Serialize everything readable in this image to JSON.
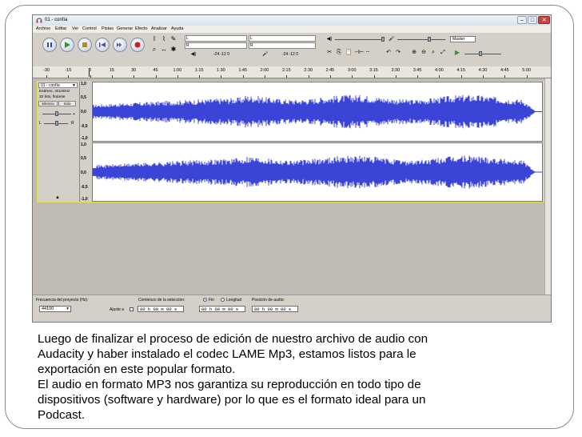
{
  "window": {
    "title": "01 - confía",
    "controls": [
      "–",
      "□",
      "✕"
    ]
  },
  "menu": [
    "Archivo",
    "Editar",
    "Ver",
    "Control",
    "Pistas",
    "Generar",
    "Efecto",
    "Analizar",
    "Ayuda"
  ],
  "toolbar": {
    "transport": [
      "pause-icon",
      "play-icon",
      "stop-icon",
      "skip-start-icon",
      "skip-end-icon",
      "record-icon"
    ],
    "meter_l": "L",
    "meter_r": "R",
    "meter_scale": "-24 -12 0",
    "meter_scale_2": "-24 -12 0",
    "mixer_label": "Master"
  },
  "ruler": {
    "ticks": [
      "-30",
      "-15",
      "0",
      "15",
      "30",
      "45",
      "1:00",
      "1:15",
      "1:30",
      "1:45",
      "2:00",
      "2:15",
      "2:30",
      "2:45",
      "3:00",
      "3:15",
      "3:30",
      "3:45",
      "4:00",
      "4:15",
      "4:30",
      "4:45",
      "5:00"
    ]
  },
  "track": {
    "name": "01 - confía",
    "info1": "Estéreo, 44100Hz",
    "info2": "32 bits, flotante",
    "mute": "Silencio",
    "solo": "Solo",
    "pan_l": "L",
    "pan_r": "R",
    "scale": [
      "1,0",
      "0,5",
      "0,0",
      "-0,5",
      "-1,0"
    ]
  },
  "status": {
    "rate_label": "Frecuencia del proyecto (Hz):",
    "rate_value": "44100",
    "selection_label": "Comienzo de la selección:",
    "end_option": "Fin",
    "length_option": "Longitud",
    "position_label": "Posición de audio:",
    "snap_label": "Ajuste a",
    "time_start": "00 h 00 m 00 s",
    "time_end": "00 h 00 m 00 s",
    "time_position": "00 h 00 m 00 s"
  },
  "caption": {
    "line1": "Luego de finalizar el proceso de edición de nuestro archivo de audio con",
    "line2": "Audacity y haber instalado el codec LAME Mp3, estamos listos para le",
    "line3": "exportación en este popular formato.",
    "line4": "El audio en formato MP3 nos garantiza su reproducción en todo tipo de",
    "line5": "dispositivos (software y hardware) por lo que es el formato ideal para un",
    "line6": "Podcast."
  }
}
